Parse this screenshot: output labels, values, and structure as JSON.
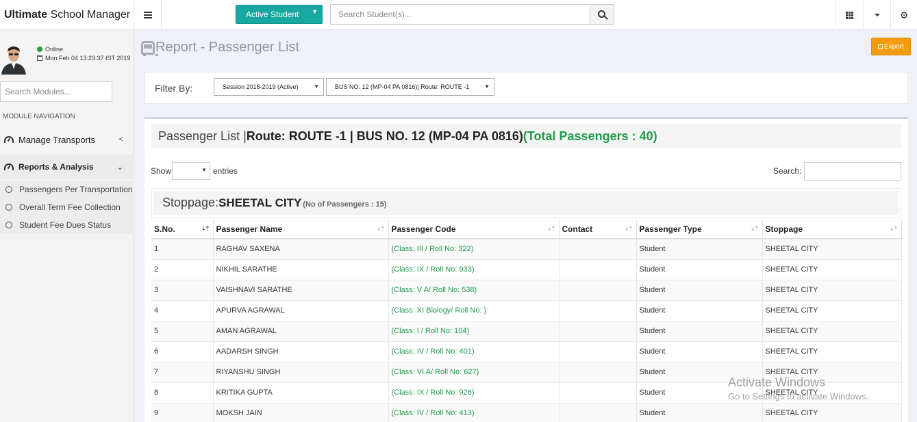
{
  "app": {
    "brand_bold": "Ultimate",
    "brand_rest": " School Manager"
  },
  "topbar": {
    "active_student_label": "Active Student",
    "search_placeholder": "Search Student(s)..."
  },
  "user": {
    "status": "Online",
    "datetime": "Mon Feb 04 13:23:37 IST 2019"
  },
  "sidebar": {
    "search_placeholder": "Search Modules...",
    "heading": "MODULE NAVIGATION",
    "items": [
      {
        "label": "Manage Transports"
      },
      {
        "label": "Reports & Analysis"
      }
    ],
    "subitems": [
      {
        "label": "Passengers Per Transportation"
      },
      {
        "label": "Overall Term Fee Collection"
      },
      {
        "label": "Student Fee Dues Status"
      }
    ]
  },
  "page": {
    "title": "Report - Passenger List",
    "export_label": "Export"
  },
  "filter": {
    "label": "Filter By:",
    "session": "Session 2018-2019 (Active)",
    "bus": "BUS NO. 12 (MP-04 PA 0816)| Route: ROUTE -1"
  },
  "panel": {
    "title_prefix": "Passenger List |",
    "title_route": "Route: ROUTE -1 | BUS NO. 12 (MP-04 PA 0816)",
    "title_total": "(Total Passengers : 40)",
    "show_label": "Show",
    "entries_label": "entries",
    "search_label": "Search:"
  },
  "stoppage": {
    "label": "Stoppage:",
    "name": "SHEETAL CITY",
    "count": "(No of Passengers : 15)"
  },
  "table": {
    "columns": [
      "S.No.",
      "Passenger Name",
      "Passenger Code",
      "Contact",
      "Passenger Type",
      "Stoppage"
    ],
    "rows": [
      [
        "1",
        "RAGHAV SAXENA",
        "(Class: III / Roll No: 322)",
        "",
        "Student",
        "SHEETAL CITY"
      ],
      [
        "2",
        "NIKHIL SARATHE",
        "(Class: IX / Roll No: 933)",
        "",
        "Student",
        "SHEETAL CITY"
      ],
      [
        "3",
        "VAISHNAVI SARATHE",
        "(Class: V A/ Roll No: 538)",
        "",
        "Student",
        "SHEETAL CITY"
      ],
      [
        "4",
        "APURVA AGRAWAL",
        "(Class: XI Biology/ Roll No: )",
        "",
        "Student",
        "SHEETAL CITY"
      ],
      [
        "5",
        "AMAN AGRAWAL",
        "(Class: I / Roll No: 104)",
        "",
        "Student",
        "SHEETAL CITY"
      ],
      [
        "6",
        "AADARSH SINGH",
        "(Class: IV / Roll No: 401)",
        "",
        "Student",
        "SHEETAL CITY"
      ],
      [
        "7",
        "RIYANSHU SINGH",
        "(Class: VI A/ Roll No: 627)",
        "",
        "Student",
        "SHEETAL CITY"
      ],
      [
        "8",
        "KRITIKA GUPTA",
        "(Class: IX / Roll No: 926)",
        "",
        "Student",
        "SHEETAL CITY"
      ],
      [
        "9",
        "MOKSH JAIN",
        "(Class: IV / Roll No: 413)",
        "",
        "Student",
        "SHEETAL CITY"
      ]
    ]
  },
  "watermark": {
    "line1": "Activate Windows",
    "line2": "Go to Settings to activate Windows."
  },
  "icons": {
    "menu": "hamburger-icon",
    "search": "search-icon",
    "apps": "grid-icon",
    "dropdown": "caret-down-icon",
    "settings": "gears-icon",
    "bus": "bus-icon",
    "dashboard": "dashboard-icon",
    "calendar": "calendar-icon"
  },
  "colors": {
    "teal": "#16a8a1",
    "orange": "#f39c12",
    "green": "#1e9c4b",
    "online": "#2e9e3e"
  }
}
